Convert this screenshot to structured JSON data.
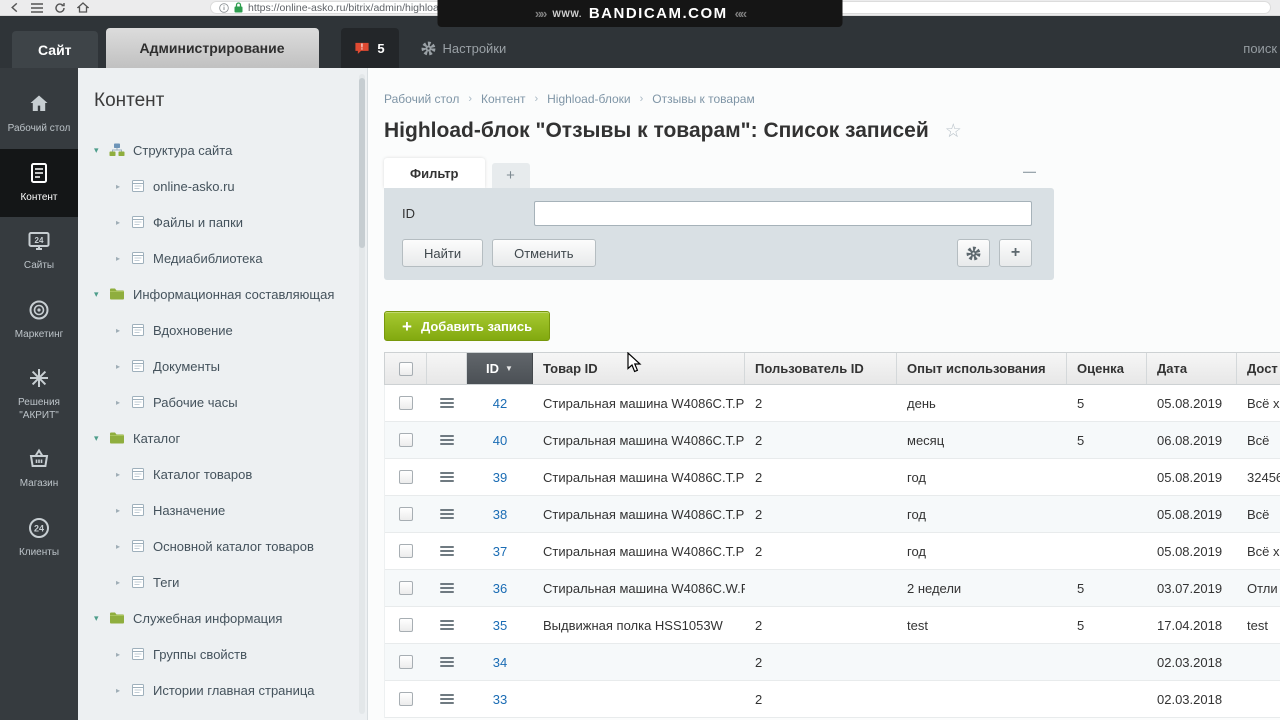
{
  "browser": {
    "url": "https://online-asko.ru/bitrix/admin/highloadblock_rows_list.php?ENTITY_ID=4&lang=ru",
    "watermark_prefix": "WWW.",
    "watermark_text": "BANDICAM.COM"
  },
  "topbar": {
    "site_tab": "Сайт",
    "admin_tab": "Администрирование",
    "notification_count": "5",
    "settings_label": "Настройки",
    "search_label": "поиск"
  },
  "rail": [
    {
      "icon": "desktop",
      "label": "Рабочий стол",
      "active": false
    },
    {
      "icon": "content",
      "label": "Контент",
      "active": true
    },
    {
      "icon": "sites",
      "label": "Сайты",
      "active": false
    },
    {
      "icon": "marketing",
      "label": "Маркетинг",
      "active": false
    },
    {
      "icon": "akrit",
      "label": "Решения \"АКРИТ\"",
      "active": false
    },
    {
      "icon": "shop",
      "label": "Магазин",
      "active": false
    },
    {
      "icon": "clients",
      "label": "Клиенты",
      "active": false
    }
  ],
  "sidebar": {
    "title": "Контент",
    "tree": [
      {
        "label": "Структура сайта",
        "level": 0,
        "icon": "site"
      },
      {
        "label": "online-asko.ru",
        "level": 1,
        "icon": "page"
      },
      {
        "label": "Файлы и папки",
        "level": 1,
        "icon": "page"
      },
      {
        "label": "Медиабиблиотека",
        "level": 1,
        "icon": "page"
      },
      {
        "label": "Информационная составляющая",
        "level": 0,
        "icon": "folder"
      },
      {
        "label": "Вдохновение",
        "level": 1,
        "icon": "page"
      },
      {
        "label": "Документы",
        "level": 1,
        "icon": "page"
      },
      {
        "label": "Рабочие часы",
        "level": 1,
        "icon": "page"
      },
      {
        "label": "Каталог",
        "level": 0,
        "icon": "folder"
      },
      {
        "label": "Каталог товаров",
        "level": 1,
        "icon": "page"
      },
      {
        "label": "Назначение",
        "level": 1,
        "icon": "page"
      },
      {
        "label": "Основной каталог товаров",
        "level": 1,
        "icon": "page"
      },
      {
        "label": "Теги",
        "level": 1,
        "icon": "page"
      },
      {
        "label": "Служебная информация",
        "level": 0,
        "icon": "folder"
      },
      {
        "label": "Группы свойств",
        "level": 1,
        "icon": "page"
      },
      {
        "label": "Истории главная страница",
        "level": 1,
        "icon": "page"
      }
    ]
  },
  "content": {
    "breadcrumb": [
      "Рабочий стол",
      "Контент",
      "Highload-блоки",
      "Отзывы к товарам"
    ],
    "page_title": "Highload-блок \"Отзывы к товарам\": Список записей",
    "filter": {
      "tab_label": "Фильтр",
      "add_tab_label": "+",
      "id_label": "ID",
      "id_value": "",
      "find_button": "Найти",
      "cancel_button": "Отменить"
    },
    "add_button_label": "Добавить запись",
    "table": {
      "headers": [
        "ID",
        "Товар ID",
        "Пользователь ID",
        "Опыт использования",
        "Оценка",
        "Дата",
        "Дост"
      ],
      "rows": [
        {
          "id": "42",
          "product": "Стиральная машина W4086C.T.P",
          "user_id": "2",
          "experience": "день",
          "rating": "5",
          "date": "05.08.2019",
          "availability": "Всё х"
        },
        {
          "id": "40",
          "product": "Стиральная машина W4086C.T.P",
          "user_id": "2",
          "experience": "месяц",
          "rating": "5",
          "date": "06.08.2019",
          "availability": "Всё"
        },
        {
          "id": "39",
          "product": "Стиральная машина W4086C.T.P",
          "user_id": "2",
          "experience": "год",
          "rating": "",
          "date": "05.08.2019",
          "availability": "32456"
        },
        {
          "id": "38",
          "product": "Стиральная машина W4086C.T.P",
          "user_id": "2",
          "experience": "год",
          "rating": "",
          "date": "05.08.2019",
          "availability": "Всё"
        },
        {
          "id": "37",
          "product": "Стиральная машина W4086C.T.P",
          "user_id": "2",
          "experience": "год",
          "rating": "",
          "date": "05.08.2019",
          "availability": "Всё х"
        },
        {
          "id": "36",
          "product": "Стиральная машина W4086C.W.P",
          "user_id": "",
          "experience": "2 недели",
          "rating": "5",
          "date": "03.07.2019",
          "availability": "Отли"
        },
        {
          "id": "35",
          "product": "Выдвижная полка HSS1053W",
          "user_id": "2",
          "experience": "test",
          "rating": "5",
          "date": "17.04.2018",
          "availability": "test"
        },
        {
          "id": "34",
          "product": "",
          "user_id": "2",
          "experience": "",
          "rating": "",
          "date": "02.03.2018",
          "availability": ""
        },
        {
          "id": "33",
          "product": "",
          "user_id": "2",
          "experience": "",
          "rating": "",
          "date": "02.03.2018",
          "availability": ""
        }
      ]
    }
  },
  "colors": {
    "header_dark": "#2f3438",
    "accent_green": "#82a90f",
    "link_blue": "#1a6cb4",
    "filter_panel": "#d9e0e4"
  }
}
